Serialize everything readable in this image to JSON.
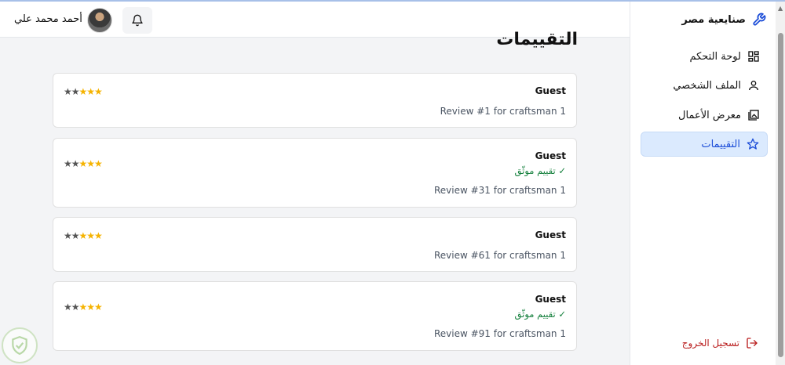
{
  "header": {
    "user_name": "أحمد محمد علي"
  },
  "sidebar": {
    "brand": "صنايعية مصر",
    "items": [
      {
        "label": "لوحة التحكم",
        "icon": "dashboard-icon",
        "active": false
      },
      {
        "label": "الملف الشخصي",
        "icon": "user-icon",
        "active": false
      },
      {
        "label": "معرض الأعمال",
        "icon": "gallery-icon",
        "active": false
      },
      {
        "label": "التقييمات",
        "icon": "star-icon",
        "active": true
      }
    ],
    "logout": "تسجيل الخروج"
  },
  "main": {
    "title": "التقييمات",
    "reviews": [
      {
        "reviewer": "Guest",
        "verified": "",
        "text": "Review #1 for craftsman 1",
        "rating": 3,
        "max_rating": 5
      },
      {
        "reviewer": "Guest",
        "verified": "✓ تقييم موثّق",
        "text": "Review #31 for craftsman 1",
        "rating": 3,
        "max_rating": 5
      },
      {
        "reviewer": "Guest",
        "verified": "",
        "text": "Review #61 for craftsman 1",
        "rating": 3,
        "max_rating": 5
      },
      {
        "reviewer": "Guest",
        "verified": "✓ تقييم موثّق",
        "text": "Review #91 for craftsman 1",
        "rating": 3,
        "max_rating": 5
      }
    ]
  },
  "colors": {
    "accent": "#1d4ed8",
    "star": "#f5b301",
    "verified": "#15803d",
    "logout": "#b91c1c"
  }
}
